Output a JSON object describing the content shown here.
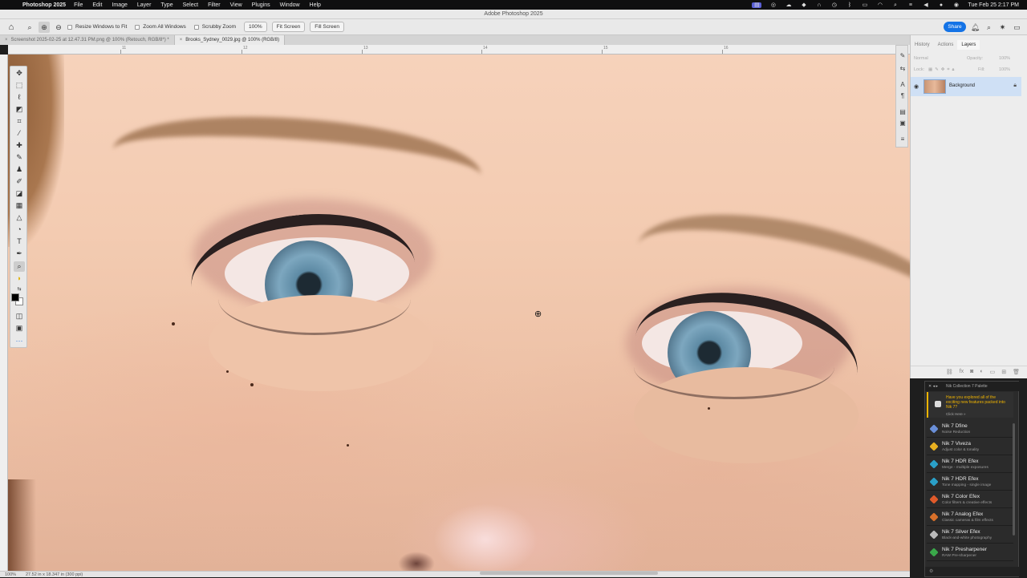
{
  "menubar": {
    "app_name": "Photoshop 2025",
    "menus": [
      "File",
      "Edit",
      "Image",
      "Layer",
      "Type",
      "Select",
      "Filter",
      "View",
      "Plugins",
      "Window",
      "Help"
    ],
    "clock": "Tue Feb 25  2:17 PM"
  },
  "window": {
    "title": "Adobe Photoshop 2025"
  },
  "options": {
    "resize_windows": "Resize Windows to Fit",
    "zoom_all": "Zoom All Windows",
    "scrubby_zoom": "Scrubby Zoom",
    "zoom_value": "100%",
    "fit_screen": "Fit Screen",
    "fill_screen": "Fill Screen",
    "share": "Share"
  },
  "tabs": [
    {
      "label": "Screenshot 2025-02-25 at 12.47.31 PM.png @ 100% (Retouch, RGB/8*) *",
      "active": false
    },
    {
      "label": "Brooks_Sydney_0029.jpg @ 100% (RGB/8)",
      "active": true
    }
  ],
  "ruler": {
    "labels": [
      "11",
      "12",
      "13",
      "14",
      "15",
      "16"
    ]
  },
  "panel": {
    "tabs": [
      "History",
      "Actions",
      "Layers"
    ],
    "active_tab": "Layers",
    "blend_mode": "Normal",
    "opacity_label": "Opacity:",
    "opacity_value": "100%",
    "lock_label": "Lock:",
    "fill_label": "Fill:",
    "fill_value": "100%",
    "layer_name": "Background"
  },
  "nik": {
    "title": "Nik Collection 7 Palette",
    "notice": "Have you explored all of the exciting new features packed into Nik 7?",
    "notice_link": "Click Here »",
    "items": [
      {
        "name": "Nik 7 Dfine",
        "desc": "Noise Reduction",
        "color": "#6a8fd8"
      },
      {
        "name": "Nik 7 Viveza",
        "desc": "Adjust color & tonality",
        "color": "#e8b020"
      },
      {
        "name": "Nik 7 HDR Efex",
        "desc": "Merge - multiple exposures",
        "color": "#2aa0c8"
      },
      {
        "name": "Nik 7 HDR Efex",
        "desc": "Tone mapping - single image",
        "color": "#2aa0c8"
      },
      {
        "name": "Nik 7 Color Efex",
        "desc": "Color filters & creative effects",
        "color": "#e05a2a"
      },
      {
        "name": "Nik 7 Analog Efex",
        "desc": "Classic cameras & film effects",
        "color": "#d8702a"
      },
      {
        "name": "Nik 7 Silver Efex",
        "desc": "Black-and-white photography",
        "color": "#bbbbbb"
      },
      {
        "name": "Nik 7 Presharpener",
        "desc": "RAW Pre-sharpener",
        "color": "#3aa84a"
      }
    ]
  },
  "status": {
    "zoom": "100%",
    "dimensions": "27.52 in x 18.347 in (300 ppi)"
  }
}
